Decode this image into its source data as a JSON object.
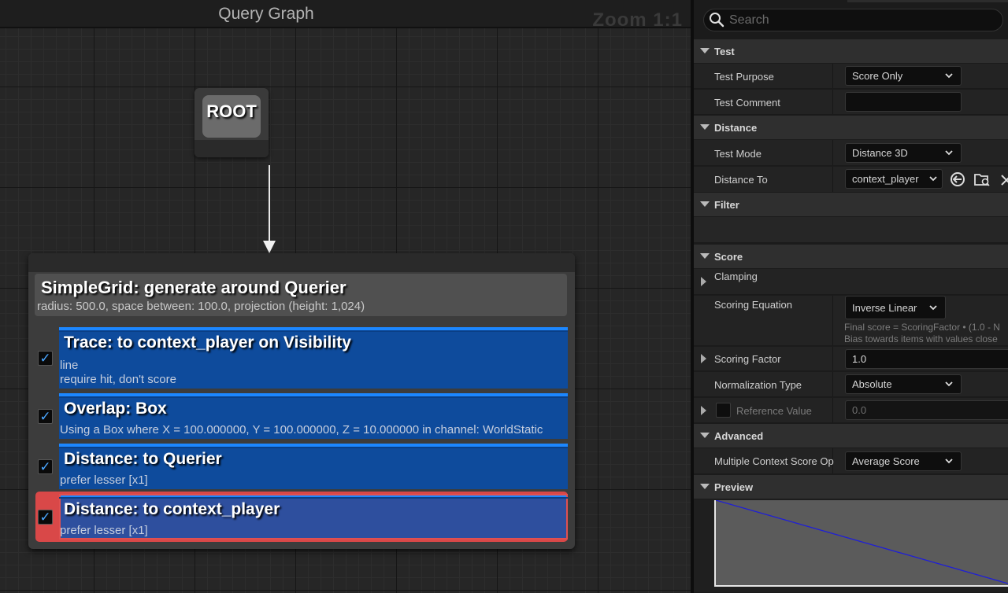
{
  "graph": {
    "title": "Query Graph",
    "zoom": "Zoom 1:1",
    "root_label": "ROOT",
    "generator": {
      "title": "SimpleGrid: generate around Querier",
      "description": "radius: 500.0, space between: 100.0, projection (height: 1,024)"
    },
    "tests": [
      {
        "title": "Trace: to context_player on Visibility",
        "lines": [
          "line",
          "require hit, don't score"
        ],
        "checked": true,
        "selected": false
      },
      {
        "title": "Overlap: Box",
        "lines": [
          "Using a Box where X = 100.000000, Y = 100.000000, Z = 10.000000 in channel: WorldStatic"
        ],
        "checked": true,
        "selected": false
      },
      {
        "title": "Distance: to Querier",
        "lines": [
          "prefer lesser [x1]"
        ],
        "checked": true,
        "selected": false
      },
      {
        "title": "Distance: to context_player",
        "lines": [
          "prefer lesser [x1]"
        ],
        "checked": true,
        "selected": true
      }
    ],
    "check_glyph": "✓"
  },
  "details": {
    "search_placeholder": "Search",
    "categories": {
      "test": "Test",
      "distance": "Distance",
      "filter": "Filter",
      "score": "Score",
      "advanced": "Advanced",
      "preview": "Preview"
    },
    "test_purpose": {
      "label": "Test Purpose",
      "value": "Score Only"
    },
    "test_comment": {
      "label": "Test Comment",
      "value": ""
    },
    "test_mode": {
      "label": "Test Mode",
      "value": "Distance 3D"
    },
    "distance_to": {
      "label": "Distance To",
      "value": "context_player"
    },
    "clamping": {
      "label": "Clamping"
    },
    "scoring_equation": {
      "label": "Scoring Equation",
      "value": "Inverse Linear",
      "hint1": "Final score = ScoringFactor • (1.0 - N",
      "hint2": "Bias towards items with values close"
    },
    "scoring_factor": {
      "label": "Scoring Factor",
      "value": "1.0"
    },
    "normalization_type": {
      "label": "Normalization Type",
      "value": "Absolute"
    },
    "reference_value": {
      "label": "Reference Value",
      "value": "0.0"
    },
    "multiple_context": {
      "label": "Multiple Context Score Op",
      "value": "Average Score"
    },
    "preview_chart": {
      "type": "line",
      "x": [
        0,
        1
      ],
      "y": [
        1,
        0
      ],
      "color": "#1f1fd6"
    }
  }
}
